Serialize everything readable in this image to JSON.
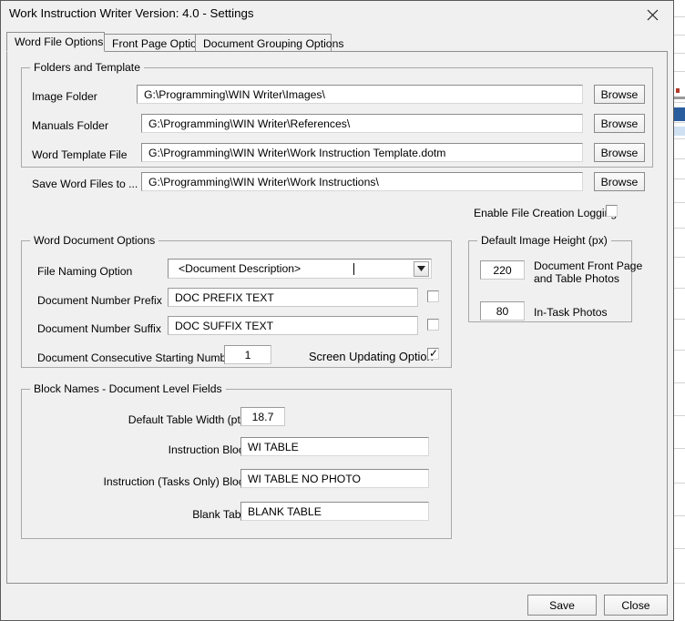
{
  "window": {
    "title": "Work Instruction Writer Version: 4.0 - Settings",
    "close_icon": "close-icon"
  },
  "tabs": [
    {
      "label": "Word File Options",
      "active": true
    },
    {
      "label": "Front Page Options",
      "active": false
    },
    {
      "label": "Document Grouping Options",
      "active": false
    }
  ],
  "folders_group": {
    "title": "Folders and Template",
    "rows": [
      {
        "label": "Image Folder",
        "value": "G:\\Programming\\WIN Writer\\Images\\",
        "button": "Browse"
      },
      {
        "label": "Manuals Folder",
        "value": "G:\\Programming\\WIN Writer\\References\\",
        "button": "Browse"
      },
      {
        "label": "Word Template File",
        "value": "G:\\Programming\\WIN Writer\\Work Instruction Template.dotm",
        "button": "Browse"
      },
      {
        "label": "Save Word Files to ...",
        "value": "G:\\Programming\\WIN Writer\\Work Instructions\\",
        "button": "Browse"
      }
    ],
    "logging_label": "Enable File Creation Logging",
    "logging_checked": false
  },
  "word_doc_group": {
    "title": "Word Document Options",
    "file_naming_label": "File Naming Option",
    "file_naming_value": "<Document Description>",
    "prefix_label": "Document Number Prefix",
    "prefix_value": "DOC PREFIX TEXT",
    "prefix_checked": false,
    "suffix_label": "Document Number Suffix",
    "suffix_value": "DOC SUFFIX TEXT",
    "suffix_checked": false,
    "consecutive_label": "Document Consecutive Starting Number",
    "consecutive_value": "1",
    "screen_updating_label": "Screen Updating Option",
    "screen_updating_checked": true
  },
  "image_height_group": {
    "title": "Default Image Height (px)",
    "front_page_value": "220",
    "front_page_label_line1": "Document Front Page",
    "front_page_label_line2": "and Table Photos",
    "in_task_value": "80",
    "in_task_label": "In-Task Photos"
  },
  "block_names_group": {
    "title": "Block Names - Document Level Fields",
    "table_width_label": "Default Table Width (pts)",
    "table_width_value": "18.7",
    "rows": [
      {
        "label": "Instruction Block",
        "value": "WI TABLE"
      },
      {
        "label": "Instruction (Tasks Only) Block",
        "value": "WI TABLE NO PHOTO"
      },
      {
        "label": "Blank Table",
        "value": "BLANK TABLE"
      }
    ]
  },
  "footer": {
    "save_label": "Save",
    "close_label": "Close"
  }
}
